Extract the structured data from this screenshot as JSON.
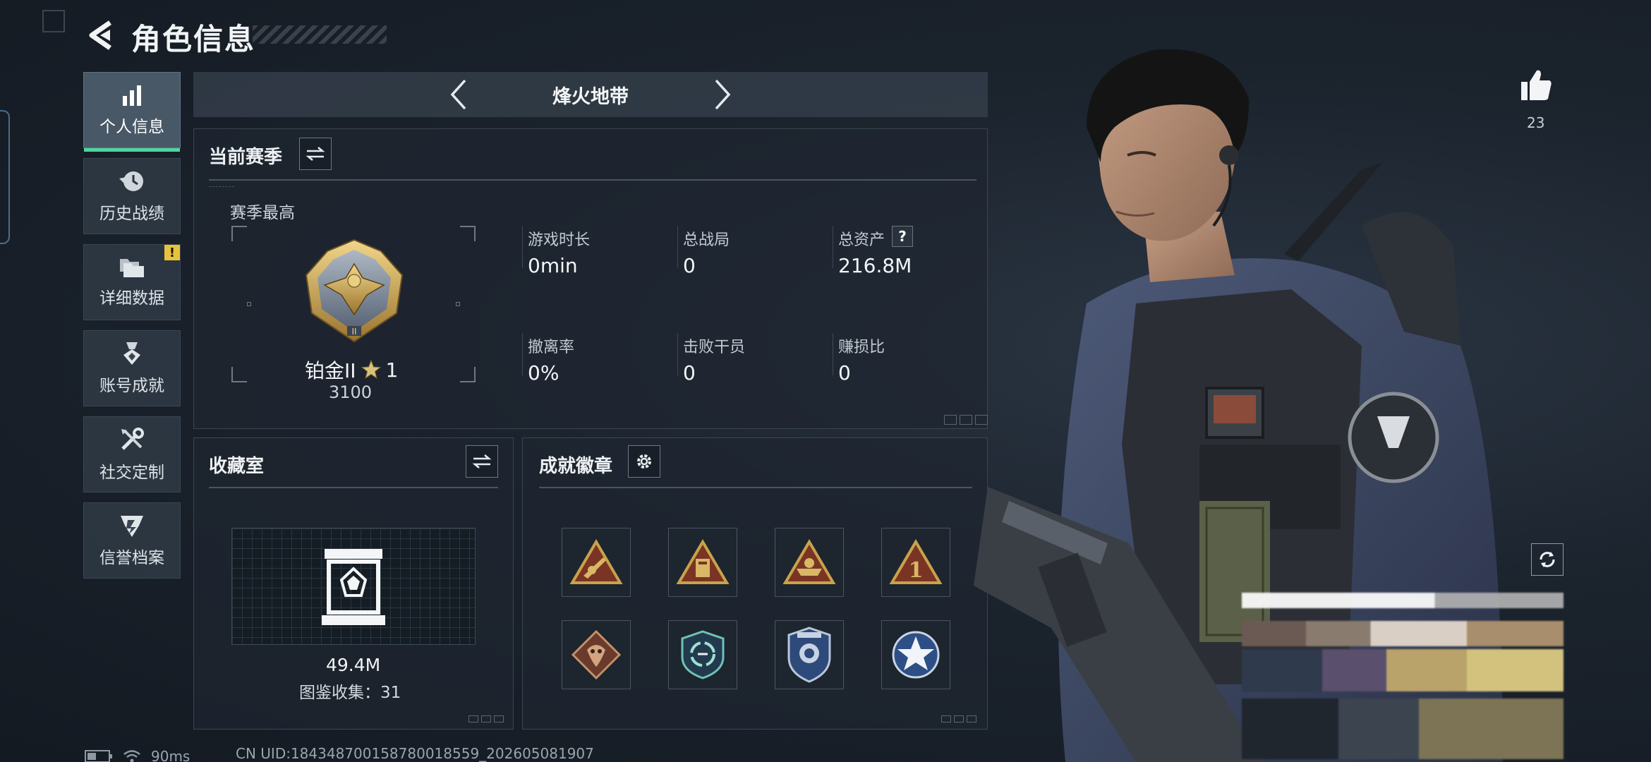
{
  "header": {
    "title": "角色信息"
  },
  "nav": {
    "items": [
      {
        "label": "个人信息",
        "icon": "bar-chart-icon",
        "active": true
      },
      {
        "label": "历史战绩",
        "icon": "history-clock-icon"
      },
      {
        "label": "详细数据",
        "icon": "folders-icon",
        "badge": "!"
      },
      {
        "label": "账号成就",
        "icon": "medal-icon"
      },
      {
        "label": "社交定制",
        "icon": "tools-icon"
      },
      {
        "label": "信誉档案",
        "icon": "shield-emblem-icon"
      }
    ]
  },
  "mode": {
    "title": "烽火地带"
  },
  "season": {
    "title": "当前赛季",
    "best_label": "赛季最高",
    "rank_name": "铂金II",
    "rank_stars": "1",
    "rank_points": "3100",
    "stats": [
      {
        "label": "游戏时长",
        "value": "0min"
      },
      {
        "label": "总战局",
        "value": "0"
      },
      {
        "label": "总资产",
        "value": "216.8M",
        "help": "?"
      },
      {
        "label": "撤离率",
        "value": "0%"
      },
      {
        "label": "击败干员",
        "value": "0"
      },
      {
        "label": "赚损比",
        "value": "0"
      }
    ]
  },
  "collection": {
    "title": "收藏室",
    "value": "49.4M",
    "count_text": "图鉴收集：31"
  },
  "badges": {
    "title": "成就徽章"
  },
  "likes": {
    "count": "23"
  },
  "footer": {
    "ping": "90ms",
    "uid": "CN UID:18434870015878001855​9_202605081907"
  },
  "colors": {
    "accent": "#4ed6a0",
    "warning": "#e8c23a",
    "gold": "#c9a24a"
  }
}
